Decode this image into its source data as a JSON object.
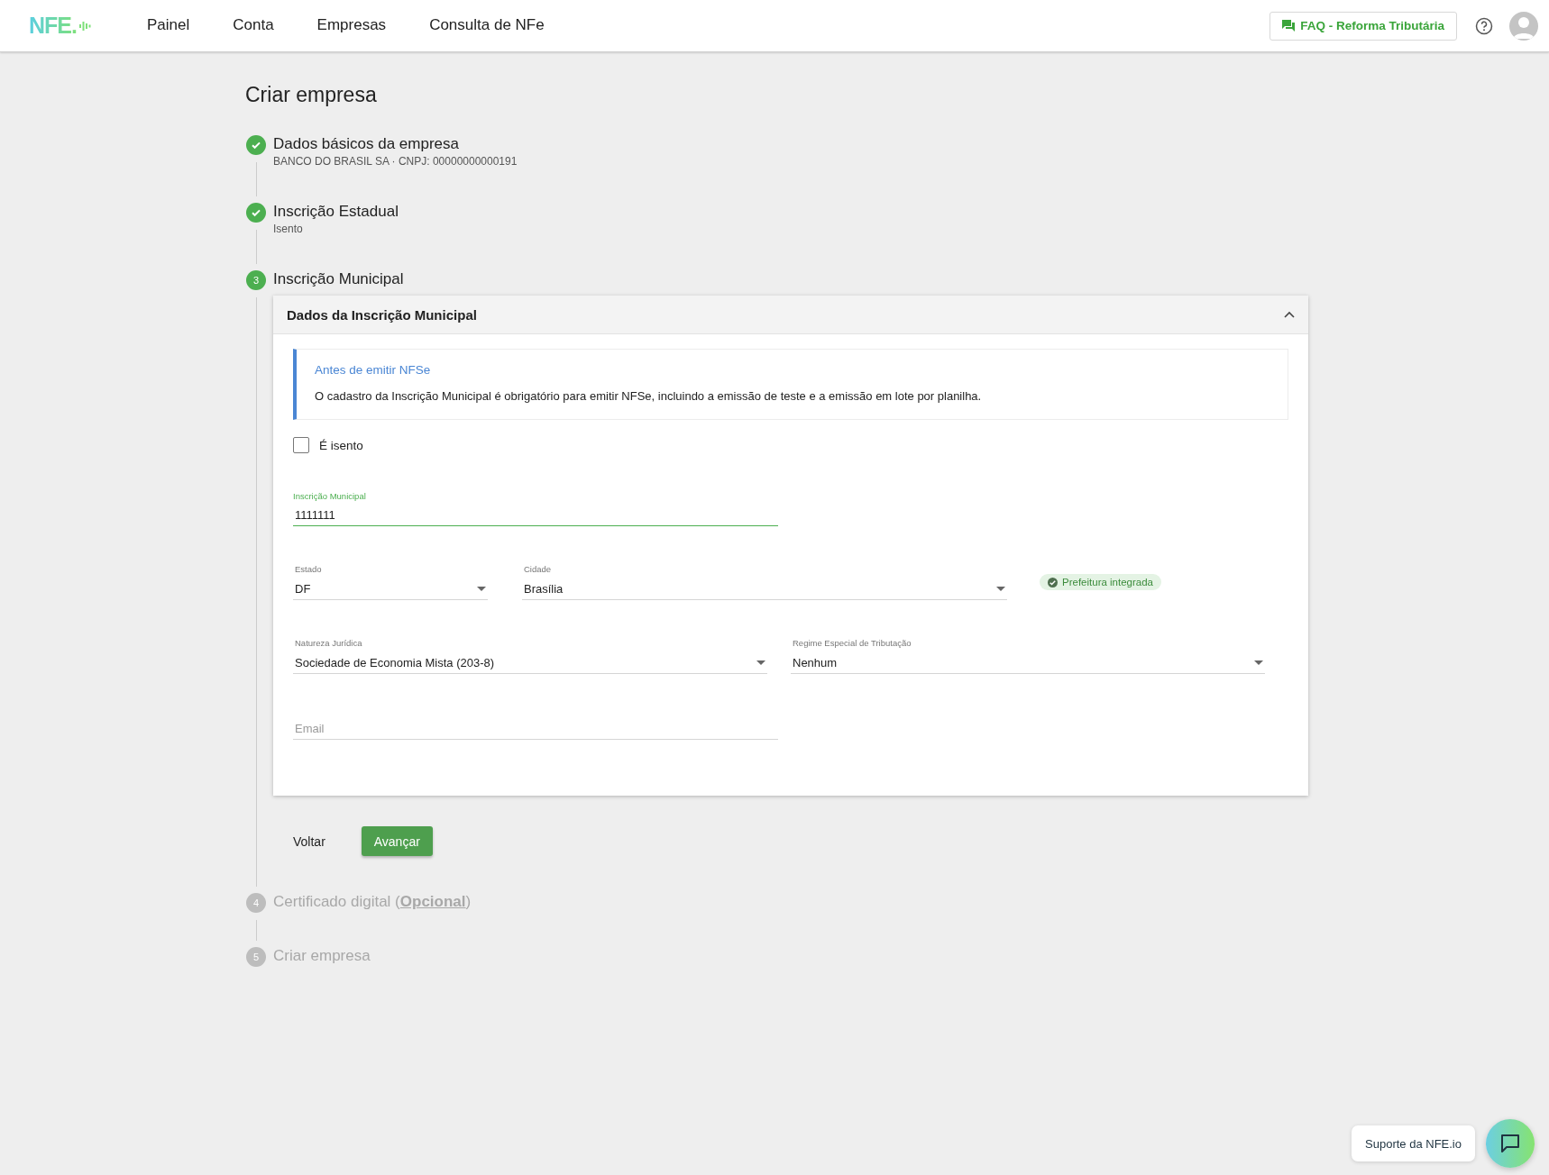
{
  "header": {
    "logo": "NFE.",
    "nav": [
      {
        "label": "Painel",
        "selected": false
      },
      {
        "label": "Conta",
        "selected": false
      },
      {
        "label": "Empresas",
        "selected": false
      },
      {
        "label": "Consulta de NFe",
        "selected": false
      }
    ],
    "faq_button": "FAQ - Reforma Tributária"
  },
  "page_title": "Criar empresa",
  "steps": [
    {
      "title": "Dados básicos da empresa",
      "subtitle": "BANCO DO BRASIL SA · CNPJ: 00000000000191",
      "done": true,
      "current": false
    },
    {
      "title": "Inscrição Estadual",
      "subtitle": "Isento",
      "done": true,
      "current": false
    },
    {
      "number": "3",
      "title": "Inscrição Municipal",
      "done": false,
      "current": true
    },
    {
      "number": "4",
      "title": "Certificado digital (**Opcional**)",
      "done": false,
      "current": false
    },
    {
      "number": "5",
      "title": "Criar empresa",
      "done": false,
      "current": false
    }
  ],
  "panel": {
    "title": "Dados da Inscrição Municipal",
    "expanded": true,
    "notice": {
      "title": "Antes de emitir NFSe",
      "text": "O cadastro da Inscrição Municipal é obrigatório para emitir NFSe, incluindo a emissão de teste e a emissão em lote por planilha."
    },
    "exempt": {
      "label": "É isento",
      "checked": false
    },
    "rows": [
      [
        {
          "kind": "text",
          "label": "Inscrição Municipal",
          "value": "1111111",
          "focused": true
        }
      ],
      [
        {
          "kind": "select",
          "label": "Estado",
          "value": "DF"
        },
        {
          "kind": "select",
          "label": "Cidade",
          "value": "Brasília"
        },
        {
          "kind": "badge",
          "text": "Prefeitura integrada"
        }
      ],
      [
        {
          "kind": "select",
          "label": "Natureza Jurídica",
          "value": "Sociedade de Economia Mista (203-8)"
        },
        {
          "kind": "select",
          "label": "Regime Especial de Tributação",
          "value": "Nenhum"
        }
      ],
      [
        {
          "kind": "text",
          "placeholder": "Email",
          "focused": false
        }
      ]
    ]
  },
  "actions": {
    "back": "Voltar",
    "next": "Avançar"
  },
  "support": {
    "label": "Suporte da NFE.io"
  }
}
